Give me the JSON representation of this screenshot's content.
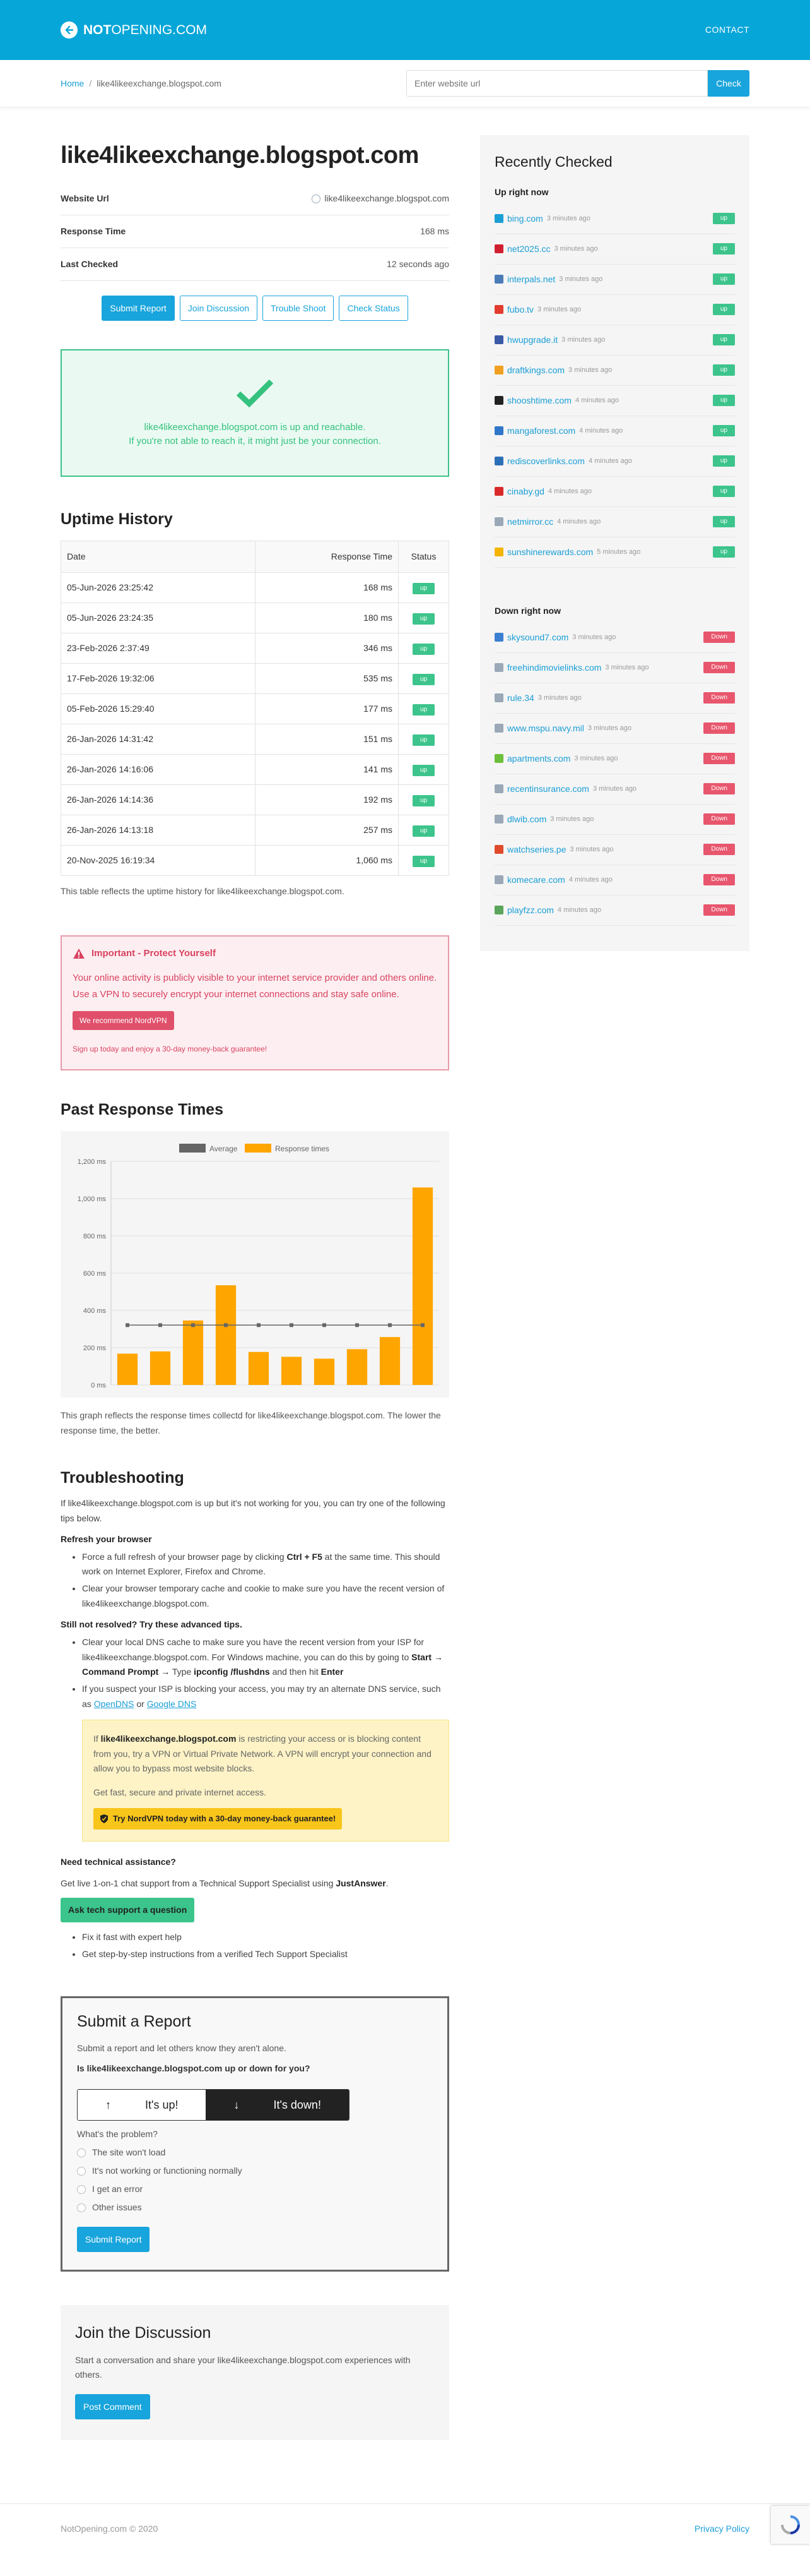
{
  "header": {
    "logo_bold": "NOT",
    "logo_rest": "OPENING.COM",
    "contact": "CONTACT"
  },
  "breadcrumb": {
    "home": "Home",
    "current": "like4likeexchange.blogspot.com"
  },
  "search": {
    "placeholder": "Enter website url",
    "button": "Check"
  },
  "site": {
    "title": "like4likeexchange.blogspot.com",
    "rows": [
      {
        "label": "Website Url",
        "value": "like4likeexchange.blogspot.com"
      },
      {
        "label": "Response Time",
        "value": "168 ms"
      },
      {
        "label": "Last Checked",
        "value": "12 seconds ago"
      }
    ]
  },
  "actions": {
    "submit": "Submit Report",
    "discuss": "Join Discussion",
    "trouble": "Trouble Shoot",
    "check": "Check Status"
  },
  "status": {
    "line1": "like4likeexchange.blogspot.com is up and reachable.",
    "line2": "If you're not able to reach it, it might just be your connection."
  },
  "uptime": {
    "title": "Uptime History",
    "headers": [
      "Date",
      "Response Time",
      "Status"
    ],
    "rows": [
      {
        "date": "05-Jun-2026 23:25:42",
        "rt": "168 ms",
        "status": "up"
      },
      {
        "date": "05-Jun-2026 23:24:35",
        "rt": "180 ms",
        "status": "up"
      },
      {
        "date": "23-Feb-2026 2:37:49",
        "rt": "346 ms",
        "status": "up"
      },
      {
        "date": "17-Feb-2026 19:32:06",
        "rt": "535 ms",
        "status": "up"
      },
      {
        "date": "05-Feb-2026 15:29:40",
        "rt": "177 ms",
        "status": "up"
      },
      {
        "date": "26-Jan-2026 14:31:42",
        "rt": "151 ms",
        "status": "up"
      },
      {
        "date": "26-Jan-2026 14:16:06",
        "rt": "141 ms",
        "status": "up"
      },
      {
        "date": "26-Jan-2026 14:14:36",
        "rt": "192 ms",
        "status": "up"
      },
      {
        "date": "26-Jan-2026 14:13:18",
        "rt": "257 ms",
        "status": "up"
      },
      {
        "date": "20-Nov-2025 16:19:34",
        "rt": "1,060 ms",
        "status": "up"
      }
    ],
    "caption": "This table reflects the uptime history for like4likeexchange.blogspot.com."
  },
  "warning": {
    "title": "Important - Protect Yourself",
    "text": "Your online activity is publicly visible to your internet service provider and others online. Use a VPN to securely encrypt your internet connections and stay safe online.",
    "button": "We recommend NordVPN",
    "small": "Sign up today and enjoy a 30-day money-back guarantee!"
  },
  "chart_title": "Past Response Times",
  "chart_data": {
    "type": "bar",
    "categories": [
      "",
      "",
      "",
      "",
      "",
      "",
      "",
      "",
      "",
      ""
    ],
    "series": [
      {
        "name": "Response times",
        "values": [
          168,
          180,
          346,
          535,
          177,
          151,
          141,
          192,
          257,
          1060
        ],
        "color": "#ffa500"
      },
      {
        "name": "Average",
        "values": [
          321,
          321,
          321,
          321,
          321,
          321,
          321,
          321,
          321,
          321
        ],
        "color": "#666666"
      }
    ],
    "ylim": [
      0,
      1200
    ],
    "yticks": [
      "0 ms",
      "200 ms",
      "400 ms",
      "600 ms",
      "800 ms",
      "1,000 ms",
      "1,200 ms"
    ],
    "legend": "top"
  },
  "chart_caption": "This graph reflects the response times collectd for like4likeexchange.blogspot.com. The lower the response time, the better.",
  "troubleshoot": {
    "title": "Troubleshooting",
    "intro": "If like4likeexchange.blogspot.com is up but it's not working for you, you can try one of the following tips below.",
    "refresh_title": "Refresh your browser",
    "refresh1_a": "Force a full refresh of your browser page by clicking",
    "refresh1_key": "Ctrl + F5",
    "refresh1_b": "at the same time. This should work on Internet Explorer, Firefox and Chrome.",
    "refresh2": "Clear your browser temporary cache and cookie to make sure you have the recent version of like4likeexchange.blogspot.com.",
    "advanced_title": "Still not resolved? Try these advanced tips.",
    "dns1_a": "Clear your local DNS cache to make sure you have the recent version from your ISP for like4likeexchange.blogspot.com. For Windows machine, you can do this by going to",
    "dns1_path": "Start → Command Prompt →",
    "dns1_type": "Type",
    "dns1_cmd": "ipconfig /flushdns",
    "dns1_then": "and then hit",
    "dns1_enter": "Enter",
    "dns2_a": "If you suspect your ISP is blocking your access, you may try an alternate DNS service, such as",
    "dns2_link1": "OpenDNS",
    "dns2_or": "or",
    "dns2_link2": "Google DNS",
    "vpn_if": "If",
    "vpn_site": "like4likeexchange.blogspot.com",
    "vpn_text": "is restricting your access or is blocking content from you, try a VPN or Virtual Private Network. A VPN will encrypt your connection and allow you to bypass most website blocks.",
    "vpn_text2": "Get fast, secure and private internet access.",
    "vpn_btn": "Try NordVPN today with a 30-day money-back guarantee!",
    "assist_title": "Need technical assistance?",
    "assist_text": "Get live 1-on-1 chat support from a Technical Support Specialist using",
    "assist_brand": "JustAnswer",
    "assist_btn": "Ask tech support a question",
    "assist_li1": "Fix it fast with expert help",
    "assist_li2": "Get step-by-step instructions from a verified Tech Support Specialist"
  },
  "report": {
    "title": "Submit a Report",
    "sub": "Submit a report and let others know they aren't alone.",
    "question": "Is like4likeexchange.blogspot.com up or down for you?",
    "up": "It's up!",
    "down": "It's down!",
    "problem": "What's the problem?",
    "options": [
      "The site won't load",
      "It's not working or functioning normally",
      "I get an error",
      "Other issues"
    ],
    "submit": "Submit Report"
  },
  "discussion": {
    "title": "Join the Discussion",
    "text": "Start a conversation and share your like4likeexchange.blogspot.com experiences with others.",
    "button": "Post Comment"
  },
  "sidebar": {
    "title": "Recently Checked",
    "up_title": "Up right now",
    "up": [
      {
        "domain": "bing.com",
        "ago": "3 minutes ago",
        "icon": "#1a9ed6"
      },
      {
        "domain": "net2025.cc",
        "ago": "3 minutes ago",
        "icon": "#d02030"
      },
      {
        "domain": "interpals.net",
        "ago": "3 minutes ago",
        "icon": "#4a7db8"
      },
      {
        "domain": "fubo.tv",
        "ago": "3 minutes ago",
        "icon": "#e23b2e"
      },
      {
        "domain": "hwupgrade.it",
        "ago": "3 minutes ago",
        "icon": "#3a5aa8"
      },
      {
        "domain": "draftkings.com",
        "ago": "3 minutes ago",
        "icon": "#f0a020"
      },
      {
        "domain": "shooshtime.com",
        "ago": "4 minutes ago",
        "icon": "#222222"
      },
      {
        "domain": "mangaforest.com",
        "ago": "4 minutes ago",
        "icon": "#2f77c9"
      },
      {
        "domain": "rediscoverlinks.com",
        "ago": "4 minutes ago",
        "icon": "#2d6fb7"
      },
      {
        "domain": "cinaby.gd",
        "ago": "4 minutes ago",
        "icon": "#d92a2a"
      },
      {
        "domain": "netmirror.cc",
        "ago": "4 minutes ago",
        "icon": "#9aa8b8"
      },
      {
        "domain": "sunshinerewards.com",
        "ago": "5 minutes ago",
        "icon": "#f4b400"
      }
    ],
    "down_title": "Down right now",
    "down": [
      {
        "domain": "skysound7.com",
        "ago": "3 minutes ago",
        "icon": "#3a7fd0"
      },
      {
        "domain": "freehindimovielinks.com",
        "ago": "3 minutes ago",
        "icon": "#9aa8b8"
      },
      {
        "domain": "rule.34",
        "ago": "3 minutes ago",
        "icon": "#9aa8b8"
      },
      {
        "domain": "www.mspu.navy.mil",
        "ago": "3 minutes ago",
        "icon": "#9aa8b8"
      },
      {
        "domain": "apartments.com",
        "ago": "3 minutes ago",
        "icon": "#6cbf3b"
      },
      {
        "domain": "recentinsurance.com",
        "ago": "3 minutes ago",
        "icon": "#9aa8b8"
      },
      {
        "domain": "dlwib.com",
        "ago": "3 minutes ago",
        "icon": "#9aa8b8"
      },
      {
        "domain": "watchseries.pe",
        "ago": "3 minutes ago",
        "icon": "#e04a2a"
      },
      {
        "domain": "komecare.com",
        "ago": "4 minutes ago",
        "icon": "#9aa8b8"
      },
      {
        "domain": "playfzz.com",
        "ago": "4 minutes ago",
        "icon": "#5aa55a"
      }
    ],
    "up_badge": "up",
    "down_badge": "Down"
  },
  "footer": {
    "copy": "NotOpening.com © 2020",
    "privacy": "Privacy Policy"
  }
}
